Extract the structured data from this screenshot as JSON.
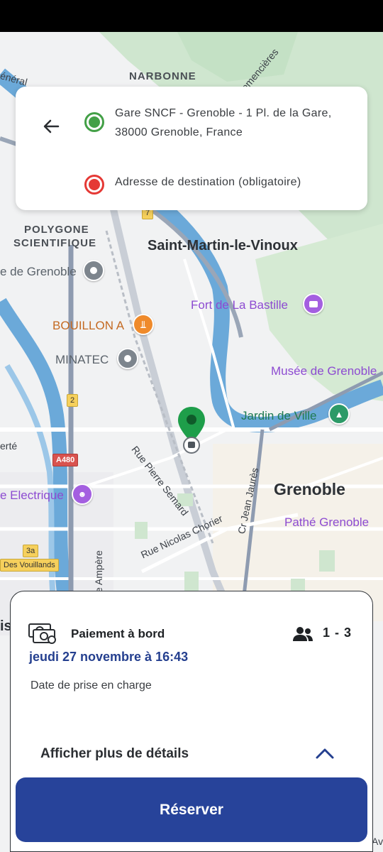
{
  "address_card": {
    "origin": "Gare SNCF - Grenoble - 1 Pl. de la Gare, 38000 Grenoble, France",
    "destination_placeholder": "Adresse de destination (obligatoire)"
  },
  "map": {
    "labels": {
      "narbonne": "NARBONNE",
      "generaux": "énéral",
      "remencieres": "emencières",
      "polygone_1": "POLYGONE",
      "polygone_2": "SCIENTIFIQUE",
      "saint_martin": "Saint-Martin-le-Vinoux",
      "de_grenoble": "e de Grenoble",
      "fort_bastille": "Fort de La Bastille",
      "bouillon": "BOUILLON A",
      "minatec": "MINATEC",
      "musee": "Musée de Grenoble",
      "jardin": "Jardin de Ville",
      "rue_semard": "Rue Pierre Semard",
      "cr_jean_jaures": "Cr Jean Jaurès",
      "grenoble": "Grenoble",
      "electrique": "e Electrique",
      "pathe": "Pathé Grenoble",
      "nicolas_chorier": "Rue Nicolas Chorier",
      "ampere": "e Ampère",
      "erte": "erté",
      "des_vouillands": "Des Vouillands",
      "is": "is",
      "av": "Av",
      "a480": "A480",
      "r2": "2",
      "r3a": "3a",
      "r7": "7"
    }
  },
  "booking": {
    "payment_label": "Paiement à bord",
    "passengers": "1 - 3",
    "pickup_datetime": "jeudi 27 novembre à 16:43",
    "pickup_caption": "Date de prise en charge",
    "details_toggle": "Afficher plus de détails",
    "reserve_button": "Réserver"
  },
  "colors": {
    "primary": "#27439a",
    "date_text": "#243f8f",
    "origin_marker": "#43a047",
    "destination_marker": "#e53935",
    "map_pin": "#1e9e4a",
    "river": "#6ba9d9"
  },
  "icons": {
    "back": "arrow-left-icon",
    "payment": "cash-icon",
    "passengers": "group-icon",
    "details": "chevron-up-icon"
  }
}
